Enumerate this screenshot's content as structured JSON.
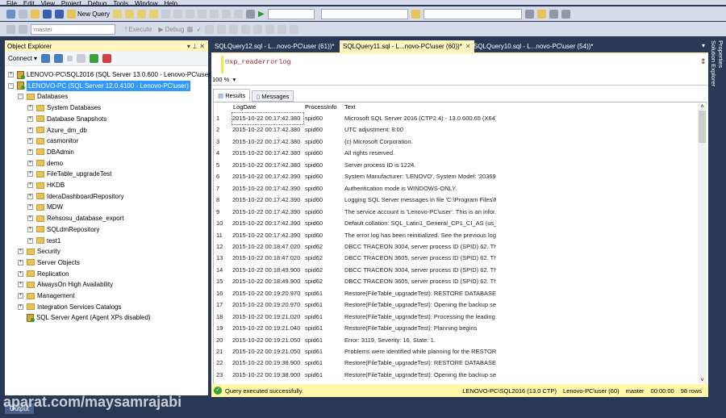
{
  "menu": [
    "File",
    "Edit",
    "View",
    "Project",
    "Debug",
    "Tools",
    "Window",
    "Help"
  ],
  "toolbar": {
    "new_query": "New Query",
    "database": "master",
    "execute": "Execute",
    "debug": "Debug"
  },
  "object_explorer": {
    "title": "Object Explorer",
    "connect": "Connect",
    "servers": [
      {
        "label": "LENOVO-PC\\SQL2016 (SQL Server 13.0.600 - Lenovo-PC\\user)",
        "expanded": false
      },
      {
        "label": "LENOVO-PC (SQL Server 12.0.4100 - Lenovo-PC\\user)",
        "expanded": true,
        "selected": true
      }
    ],
    "databases_label": "Databases",
    "databases": [
      "System Databases",
      "Database Snapshots",
      "Azure_dm_db",
      "casmonitor",
      "DBAdmin",
      "demo",
      "FileTable_upgradeTest",
      "HKDB",
      "IderaDashboardRepository",
      "MDW",
      "Rehsosu_database_export",
      "SQLdmRepository",
      "test1"
    ],
    "server_nodes": [
      "Security",
      "Server Objects",
      "Replication",
      "AlwaysOn High Availability",
      "Management",
      "Integration Services Catalogs",
      "SQL Server Agent (Agent XPs disabled)"
    ]
  },
  "tabs": [
    {
      "label": "SQLQuery12.sql - L...novo-PC\\user (61))*",
      "active": false
    },
    {
      "label": "SQLQuery11.sql - L...novo-PC\\user (60))*",
      "active": true
    },
    {
      "label": "SQLQuery10.sql - L...novo-PC\\user (54))*",
      "active": false
    }
  ],
  "editor": {
    "code": "xp_readerrorlog",
    "zoom": "100 %"
  },
  "result_tabs": [
    "Results",
    "Messages"
  ],
  "columns": [
    "LogDate",
    "ProcessInfo",
    "Text"
  ],
  "rows": [
    [
      "1",
      "2015-10-22 00:17:42.380",
      "spid60",
      "Microsoft SQL Server 2016 (CTP2.4) - 13.0.600.65 (X64) ..."
    ],
    [
      "2",
      "2015-10-22 00:17:42.380",
      "spid60",
      "UTC adjustment: 8:00"
    ],
    [
      "3",
      "2015-10-22 00:17:42.380",
      "spid60",
      "(c) Microsoft Corporation."
    ],
    [
      "4",
      "2015-10-22 00:17:42.380",
      "spid60",
      "All rights reserved."
    ],
    [
      "5",
      "2015-10-22 00:17:42.380",
      "spid60",
      "Server process ID is 1224."
    ],
    [
      "6",
      "2015-10-22 00:17:42.390",
      "spid60",
      "System Manufacturer: 'LENOVO', System Model: '20369'."
    ],
    [
      "7",
      "2015-10-22 00:17:42.390",
      "spid60",
      "Authentication mode is WINDOWS-ONLY."
    ],
    [
      "8",
      "2015-10-22 00:17:42.390",
      "spid60",
      "Logging SQL Server messages in file 'C:\\Program Files\\M..."
    ],
    [
      "9",
      "2015-10-22 00:17:42.390",
      "spid60",
      "The service account is 'Lenovo-PC\\user'. This is an infor..."
    ],
    [
      "10",
      "2015-10-22 00:17:42.390",
      "spid60",
      "Default collation: SQL_Latin1_General_CP1_CI_AS (us_..."
    ],
    [
      "11",
      "2015-10-22 00:17:42.390",
      "spid60",
      "The error log has been reinitialized. See the previous log f..."
    ],
    [
      "12",
      "2015-10-22 00:18:47.020",
      "spid62",
      "DBCC TRACEON 3004, server process ID (SPID) 62. Thi..."
    ],
    [
      "13",
      "2015-10-22 00:18:47.020",
      "spid62",
      "DBCC TRACEON 3605, server process ID (SPID) 62. Thi..."
    ],
    [
      "14",
      "2015-10-22 00:18:49.900",
      "spid62",
      "DBCC TRACEON 3004, server process ID (SPID) 62. Thi..."
    ],
    [
      "15",
      "2015-10-22 00:18:49.900",
      "spid62",
      "DBCC TRACEON 3605, server process ID (SPID) 62. Thi..."
    ],
    [
      "16",
      "2015-10-22 00:19:20.970",
      "spid61",
      "Restore(FileTable_upgradeTest): RESTORE DATABASE..."
    ],
    [
      "17",
      "2015-10-22 00:19:20.970",
      "spid61",
      "Restore(FileTable_upgradeTest): Opening the backup set"
    ],
    [
      "18",
      "2015-10-22 00:19:21.020",
      "spid61",
      "Restore(FileTable_upgradeTest): Processing the leading ..."
    ],
    [
      "19",
      "2015-10-22 00:19:21.040",
      "spid61",
      "Restore(FileTable_upgradeTest): Planning begins"
    ],
    [
      "20",
      "2015-10-22 00:19:21.050",
      "spid61",
      "Error: 3119, Severity: 16, State: 1."
    ],
    [
      "21",
      "2015-10-22 00:19:21.050",
      "spid61",
      "Problems were identified while planning for the RESTOR..."
    ],
    [
      "22",
      "2015-10-22 00:19:38.900",
      "spid61",
      "Restore(FileTable_upgradeTest): RESTORE DATABASE..."
    ],
    [
      "23",
      "2015-10-22 00:19:38.900",
      "spid61",
      "Restore(FileTable_upgradeTest): Opening the backup set"
    ]
  ],
  "status": {
    "message": "Query executed successfully.",
    "server": "LENOVO-PC\\SQL2016 (13.0 CTP)",
    "user": "Lenovo-PC\\user (60)",
    "db": "master",
    "time": "00:00:00",
    "rows": "98 rows"
  },
  "side": [
    "Properties",
    "Solution Explorer"
  ],
  "output_tab": "Output",
  "watermark": "aparat.com/maysamrajabi"
}
